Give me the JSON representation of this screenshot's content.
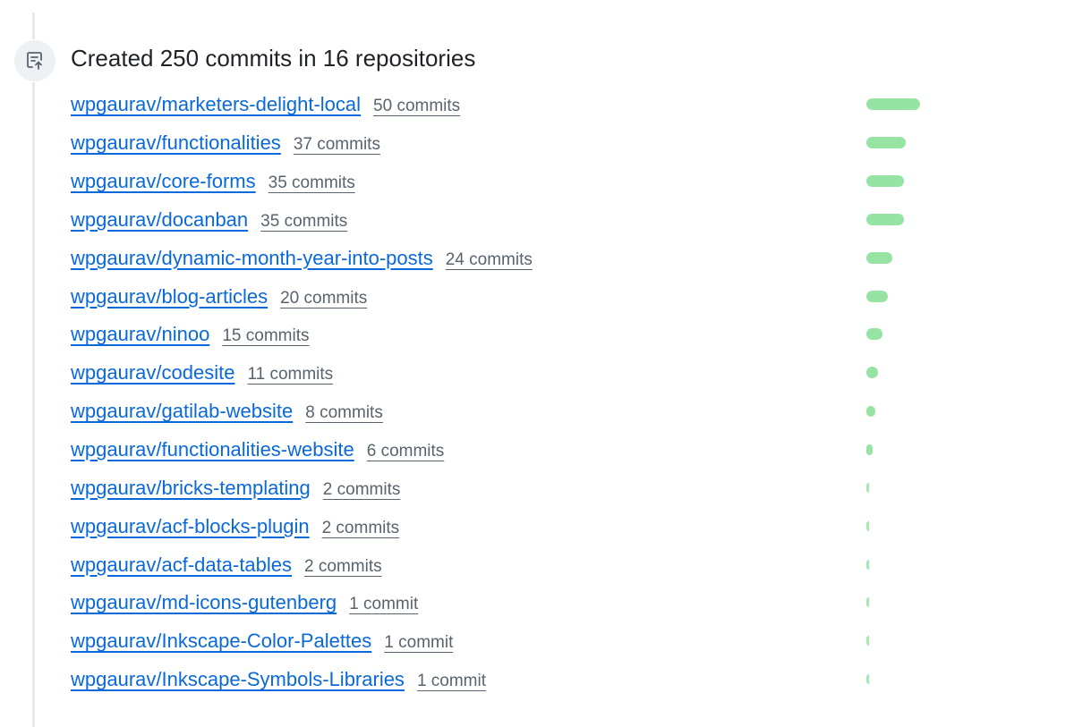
{
  "heading": "Created 250 commits in 16 repositories",
  "icon": "repo-push-icon",
  "colors": {
    "link": "#0969da",
    "muted": "#59636e",
    "bar": "#97e3a4",
    "timeline": "#e6e8eb"
  },
  "max_commits": 50,
  "repos": [
    {
      "name": "wpgaurav/marketers-delight-local",
      "commits_label": "50 commits",
      "commits": 50
    },
    {
      "name": "wpgaurav/functionalities",
      "commits_label": "37 commits",
      "commits": 37
    },
    {
      "name": "wpgaurav/core-forms",
      "commits_label": "35 commits",
      "commits": 35
    },
    {
      "name": "wpgaurav/docanban",
      "commits_label": "35 commits",
      "commits": 35
    },
    {
      "name": "wpgaurav/dynamic-month-year-into-posts",
      "commits_label": "24 commits",
      "commits": 24
    },
    {
      "name": "wpgaurav/blog-articles",
      "commits_label": "20 commits",
      "commits": 20
    },
    {
      "name": "wpgaurav/ninoo",
      "commits_label": "15 commits",
      "commits": 15
    },
    {
      "name": "wpgaurav/codesite",
      "commits_label": "11 commits",
      "commits": 11
    },
    {
      "name": "wpgaurav/gatilab-website",
      "commits_label": "8 commits",
      "commits": 8
    },
    {
      "name": "wpgaurav/functionalities-website",
      "commits_label": "6 commits",
      "commits": 6
    },
    {
      "name": "wpgaurav/bricks-templating",
      "commits_label": "2 commits",
      "commits": 2
    },
    {
      "name": "wpgaurav/acf-blocks-plugin",
      "commits_label": "2 commits",
      "commits": 2
    },
    {
      "name": "wpgaurav/acf-data-tables",
      "commits_label": "2 commits",
      "commits": 2
    },
    {
      "name": "wpgaurav/md-icons-gutenberg",
      "commits_label": "1 commit",
      "commits": 1
    },
    {
      "name": "wpgaurav/Inkscape-Color-Palettes",
      "commits_label": "1 commit",
      "commits": 1
    },
    {
      "name": "wpgaurav/Inkscape-Symbols-Libraries",
      "commits_label": "1 commit",
      "commits": 1
    }
  ]
}
